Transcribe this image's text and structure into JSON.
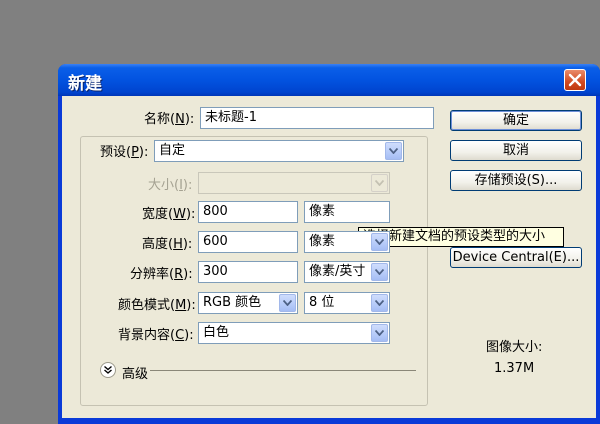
{
  "dialog": {
    "title": "新建"
  },
  "name": {
    "label_prefix": "名称(",
    "key": "N",
    "label_suffix": "):",
    "value": "未标题-1"
  },
  "preset": {
    "label_prefix": "预设(",
    "key": "P",
    "label_suffix": "):",
    "value": "自定"
  },
  "size": {
    "label_prefix": "大小(",
    "key": "I",
    "label_suffix": "):",
    "value": ""
  },
  "width": {
    "label_prefix": "宽度(",
    "key": "W",
    "label_suffix": "):",
    "value": "800",
    "unit": "像素"
  },
  "height": {
    "label_prefix": "高度(",
    "key": "H",
    "label_suffix": "):",
    "value": "600",
    "unit": "像素"
  },
  "resolution": {
    "label_prefix": "分辨率(",
    "key": "R",
    "label_suffix": "):",
    "value": "300",
    "unit": "像素/英寸"
  },
  "color_mode": {
    "label_prefix": "颜色模式(",
    "key": "M",
    "label_suffix": "):",
    "value": "RGB 颜色",
    "depth": "8 位"
  },
  "background": {
    "label_prefix": "背景内容(",
    "key": "C",
    "label_suffix": "):",
    "value": "白色"
  },
  "advanced": {
    "label": "高级"
  },
  "buttons": {
    "ok": "确定",
    "cancel": "取消",
    "save_preset": "存储预设(S)...",
    "device_central": "Device Central(E)..."
  },
  "tooltip": "选择新建文档的预设类型的大小",
  "image_size": {
    "label": "图像大小:",
    "value": "1.37M"
  },
  "colors": {
    "titlebar": "#0253e0",
    "dialog_bg": "#ece9d8",
    "close": "#d14a20"
  }
}
